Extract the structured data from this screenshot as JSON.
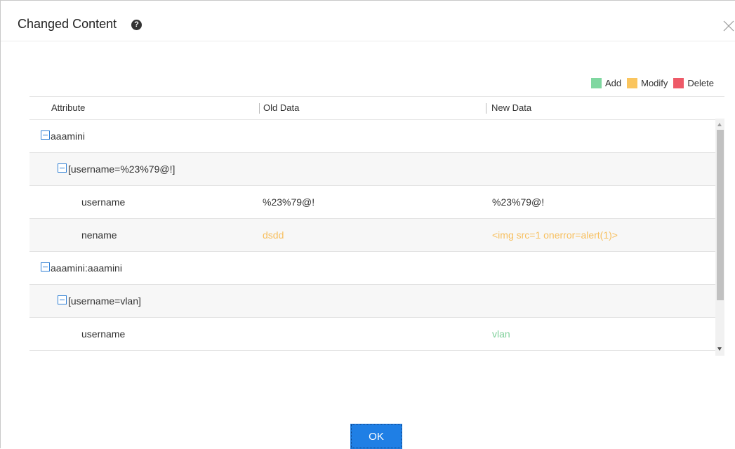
{
  "dialog": {
    "title": "Changed Content",
    "help_glyph": "?",
    "close_icon": "close-icon"
  },
  "legend": {
    "items": [
      {
        "label": "Add",
        "color": "#7fd7a0"
      },
      {
        "label": "Modify",
        "color": "#fac55e"
      },
      {
        "label": "Delete",
        "color": "#ee5a68"
      }
    ]
  },
  "table": {
    "columns": [
      "Attribute",
      "Old Data",
      "New Data"
    ],
    "rows": [
      {
        "attribute": "aaamini",
        "old": "",
        "new": "",
        "status": ""
      },
      {
        "attribute": "[username=%23%79@!]",
        "old": "",
        "new": "",
        "status": ""
      },
      {
        "attribute": "username",
        "old": "%23%79@!",
        "new": "%23%79@!",
        "status": ""
      },
      {
        "attribute": "nename",
        "old": "dsdd",
        "new": "<img src=1 onerror=alert(1)>",
        "status": "modify"
      },
      {
        "attribute": "aaamini:aaamini",
        "old": "",
        "new": "",
        "status": ""
      },
      {
        "attribute": "[username=vlan]",
        "old": "",
        "new": "",
        "status": ""
      },
      {
        "attribute": "username",
        "old": "",
        "new": "vlan",
        "status": "add"
      }
    ]
  },
  "footer": {
    "ok_label": "OK"
  }
}
